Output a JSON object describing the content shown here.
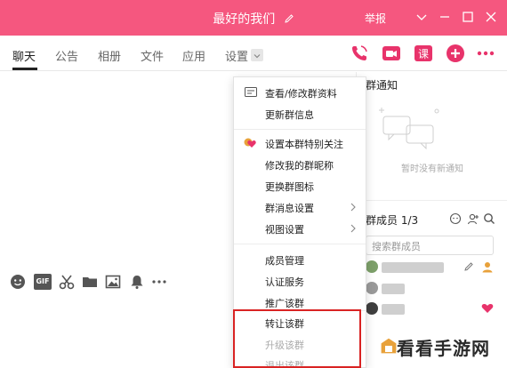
{
  "window": {
    "title": "最好的我们",
    "report": "举报"
  },
  "tabs": [
    "聊天",
    "公告",
    "相册",
    "文件",
    "应用",
    "设置"
  ],
  "menu": {
    "items": [
      "查看/修改群资料",
      "更新群信息",
      "设置本群特别关注",
      "修改我的群昵称",
      "更换群图标",
      "群消息设置",
      "视图设置",
      "成员管理",
      "认证服务",
      "推广该群",
      "转让该群",
      "升级该群",
      "退出该群"
    ]
  },
  "right_panel": {
    "notice_title": "群通知",
    "notice_empty": "暂时没有新通知",
    "members_title": "群成员 1/3",
    "member_search_placeholder": "搜索群成员"
  },
  "toolbar": {
    "gif_label": "GIF"
  },
  "watermark": "看看手游网",
  "colors": {
    "titlebar": "#f5577f",
    "accent_pink": "#e8336b",
    "highlight_red": "#d92323"
  }
}
